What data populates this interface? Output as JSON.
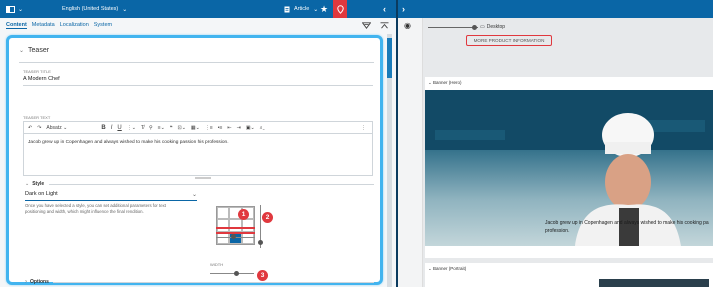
{
  "topbar": {
    "language": "English (United States)",
    "doc_type": "Article"
  },
  "tabs": [
    {
      "label": "Content"
    },
    {
      "label": "Metadata"
    },
    {
      "label": "Localization"
    },
    {
      "label": "System"
    }
  ],
  "teaser": {
    "section_title": "Teaser",
    "title_label": "TEASER TITLE",
    "title_value": "A Modern Chef",
    "text_label": "TEASER TEXT",
    "toolbar_format": "Absatz",
    "text_value": "Jacob grew up in Copenhagen and always wished to make his cooking passion his profession."
  },
  "style": {
    "label": "Style",
    "selected": "Dark on Light",
    "help": "Once you have selected a style, you can set additional parameters for text positioning and width, which might influence the final rendition.",
    "width_label": "WIDTH",
    "badges": [
      "1",
      "2",
      "3"
    ]
  },
  "options": {
    "label": "Options"
  },
  "preview": {
    "device": "Desktop",
    "more_button": "MORE PRODUCT INFORMATION",
    "hero_title": "Banner (Hero)",
    "hero_caption": "Jacob grew up in Copenhagen and always wished to make his cooking pa profession.",
    "portrait_title": "Banner (Portrait)"
  },
  "colors": {
    "brand_blue": "#0a66a6",
    "accent_red": "#e0383e",
    "focus_outline": "#42b4ef"
  }
}
